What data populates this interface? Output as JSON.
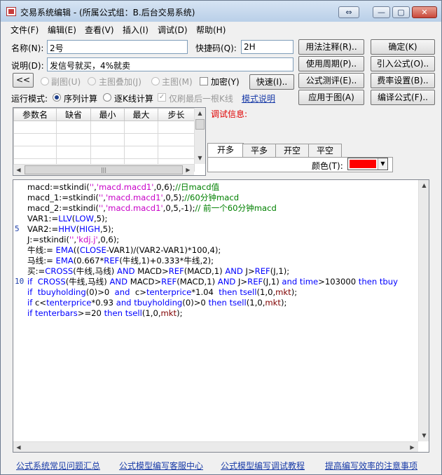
{
  "window": {
    "title": "交易系统编辑 - (所属公式组：B.后台交易系统)",
    "buttons": {
      "swap": "⇔",
      "minimize": "—",
      "maximize": "▢",
      "close": "✕"
    }
  },
  "menubar": [
    "文件(F)",
    "编辑(E)",
    "查看(V)",
    "插入(I)",
    "调试(D)",
    "帮助(H)"
  ],
  "form": {
    "name_label": "名称(N):",
    "name_value": "2号",
    "shortcut_label": "快捷码(Q):",
    "shortcut_value": "2H",
    "desc_label": "说明(D):",
    "desc_value": "发信号就买，4%就卖",
    "collapse_button": "<<",
    "chart_options": [
      "副图(U)",
      "主图叠加(J)",
      "主图(M)"
    ],
    "encrypt_label": "加密(Y)",
    "quick_button": "快速(I)..",
    "run_mode_label": "运行模式:",
    "run_modes": [
      "序列计算",
      "逐K线计算"
    ],
    "last_bar_label": "仅刷最后一根K线",
    "mode_help_link": "模式说明"
  },
  "right_buttons": {
    "usage_notes": "用法注释(R)..",
    "confirm": "确定(K)",
    "use_period": "使用周期(P)..",
    "import_formula": "引入公式(O)..",
    "formula_test": "公式测评(E)..",
    "fee_settings": "费率设置(B)..",
    "apply_to_chart": "应用于图(A)",
    "compile_formula": "编译公式(F).."
  },
  "param_table": {
    "headers": [
      "参数名",
      "缺省",
      "最小",
      "最大",
      "步长"
    ],
    "rows": 4
  },
  "debug_label": "调试信息:",
  "signal_tabs": [
    "开多",
    "平多",
    "开空",
    "平空"
  ],
  "color_label": "颜色(T):",
  "colors": {
    "signal_color": "#ff0000",
    "title_gradient_top": "#d6e4f3",
    "accent_link": "#1a3ca8"
  },
  "code": {
    "line_numbers": [
      {
        "n": "5",
        "line": 5
      },
      {
        "n": "10",
        "line": 10
      }
    ],
    "lines": [
      [
        {
          "t": "macd:=stkindi("
        },
        {
          "t": "''",
          "c": "str"
        },
        {
          "t": ","
        },
        {
          "t": "'macd.macd1'",
          "c": "str"
        },
        {
          "t": ",0,6);"
        },
        {
          "t": "//日macd值",
          "c": "cmt"
        }
      ],
      [
        {
          "t": "macd_1:=stkindi("
        },
        {
          "t": "''",
          "c": "str"
        },
        {
          "t": ","
        },
        {
          "t": "'macd.macd1'",
          "c": "str"
        },
        {
          "t": ",0,5);"
        },
        {
          "t": "//60分钟macd",
          "c": "cmt"
        }
      ],
      [
        {
          "t": "macd_2:=stkindi("
        },
        {
          "t": "''",
          "c": "str"
        },
        {
          "t": ","
        },
        {
          "t": "'macd.macd1'",
          "c": "str"
        },
        {
          "t": ",0,5,-1);"
        },
        {
          "t": "// 前一个60分钟macd",
          "c": "cmt"
        }
      ],
      [
        {
          "t": "VAR1:="
        },
        {
          "t": "LLV",
          "c": "kw"
        },
        {
          "t": "("
        },
        {
          "t": "LOW",
          "c": "kw"
        },
        {
          "t": ",5);"
        }
      ],
      [
        {
          "t": "VAR2:="
        },
        {
          "t": "HHV",
          "c": "kw"
        },
        {
          "t": "("
        },
        {
          "t": "HIGH",
          "c": "kw"
        },
        {
          "t": ",5);"
        }
      ],
      [
        {
          "t": "J:=stkindi("
        },
        {
          "t": "''",
          "c": "str"
        },
        {
          "t": ","
        },
        {
          "t": "'kdj.j'",
          "c": "str"
        },
        {
          "t": ",0,6);"
        }
      ],
      [
        {
          "t": "牛线:= "
        },
        {
          "t": "EMA",
          "c": "kw"
        },
        {
          "t": "(("
        },
        {
          "t": "CLOSE",
          "c": "kw"
        },
        {
          "t": "-VAR1)/(VAR2-VAR1)*100,4);"
        }
      ],
      [
        {
          "t": "马线:= "
        },
        {
          "t": "EMA",
          "c": "kw"
        },
        {
          "t": "(0.667*"
        },
        {
          "t": "REF",
          "c": "kw"
        },
        {
          "t": "(牛线,1)+0.333*牛线,2);"
        }
      ],
      [
        {
          "t": "买:="
        },
        {
          "t": "CROSS",
          "c": "kw"
        },
        {
          "t": "(牛线,马线) "
        },
        {
          "t": "AND",
          "c": "kw"
        },
        {
          "t": " MACD>"
        },
        {
          "t": "REF",
          "c": "kw"
        },
        {
          "t": "(MACD,1) "
        },
        {
          "t": "AND",
          "c": "kw"
        },
        {
          "t": " J>"
        },
        {
          "t": "REF",
          "c": "kw"
        },
        {
          "t": "(J,1);"
        }
      ],
      [
        {
          "t": "if",
          "c": "kw"
        },
        {
          "t": "  "
        },
        {
          "t": "CROSS",
          "c": "kw"
        },
        {
          "t": "(牛线,马线) "
        },
        {
          "t": "AND",
          "c": "kw"
        },
        {
          "t": " MACD>"
        },
        {
          "t": "REF",
          "c": "kw"
        },
        {
          "t": "(MACD,1) "
        },
        {
          "t": "AND",
          "c": "kw"
        },
        {
          "t": " J>"
        },
        {
          "t": "REF",
          "c": "kw"
        },
        {
          "t": "(J,1) "
        },
        {
          "t": "and",
          "c": "kw"
        },
        {
          "t": " "
        },
        {
          "t": "time",
          "c": "kw"
        },
        {
          "t": ">103000 "
        },
        {
          "t": "then",
          "c": "kw"
        },
        {
          "t": " "
        },
        {
          "t": "tbuy",
          "c": "kw"
        }
      ],
      [
        {
          "t": "if",
          "c": "kw"
        },
        {
          "t": "  "
        },
        {
          "t": "tbuyholding",
          "c": "kw"
        },
        {
          "t": "(0)>0  "
        },
        {
          "t": "and",
          "c": "kw"
        },
        {
          "t": "  c>"
        },
        {
          "t": "tenterprice",
          "c": "kw"
        },
        {
          "t": "*1.04  "
        },
        {
          "t": "then",
          "c": "kw"
        },
        {
          "t": " "
        },
        {
          "t": "tsell",
          "c": "kw"
        },
        {
          "t": "(1,0,"
        },
        {
          "t": "mkt",
          "c": "var"
        },
        {
          "t": ");"
        }
      ],
      [
        {
          "t": "if",
          "c": "kw"
        },
        {
          "t": " c<"
        },
        {
          "t": "tenterprice",
          "c": "kw"
        },
        {
          "t": "*0.93 "
        },
        {
          "t": "and",
          "c": "kw"
        },
        {
          "t": " "
        },
        {
          "t": "tbuyholding",
          "c": "kw"
        },
        {
          "t": "(0)>0 "
        },
        {
          "t": "then",
          "c": "kw"
        },
        {
          "t": " "
        },
        {
          "t": "tsell",
          "c": "kw"
        },
        {
          "t": "(1,0,"
        },
        {
          "t": "mkt",
          "c": "var"
        },
        {
          "t": ");"
        }
      ],
      [
        {
          "t": "if",
          "c": "kw"
        },
        {
          "t": " "
        },
        {
          "t": "tenterbars",
          "c": "kw"
        },
        {
          "t": ">=20 "
        },
        {
          "t": "then",
          "c": "kw"
        },
        {
          "t": " "
        },
        {
          "t": "tsell",
          "c": "kw"
        },
        {
          "t": "(1,0,"
        },
        {
          "t": "mkt",
          "c": "var"
        },
        {
          "t": ");"
        }
      ]
    ]
  },
  "footer_links": [
    "公式系统常见问题汇总",
    "公式模型编写客服中心",
    "公式模型编写调试教程",
    "提高编写效率的注意事项"
  ]
}
